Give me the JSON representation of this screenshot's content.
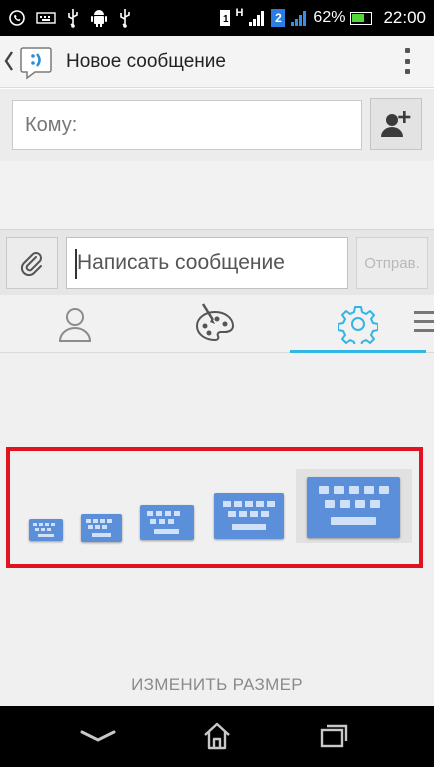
{
  "status_bar": {
    "network": "H",
    "sim_slot": "2",
    "battery": "62%",
    "time": "22:00"
  },
  "action_bar": {
    "title": "Новое сообщение"
  },
  "compose": {
    "to_placeholder": "Кому:",
    "message_placeholder": "Написать сообщение",
    "send_label": "Отправ."
  },
  "keyboard_size": {
    "options": 5,
    "selected_index": 4,
    "resize_label": "ИЗМЕНИТЬ РАЗМЕР"
  },
  "colors": {
    "accent": "#33b5e5",
    "keyboard_icon": "#5b8fd9",
    "highlight_box": "#e0141e"
  }
}
